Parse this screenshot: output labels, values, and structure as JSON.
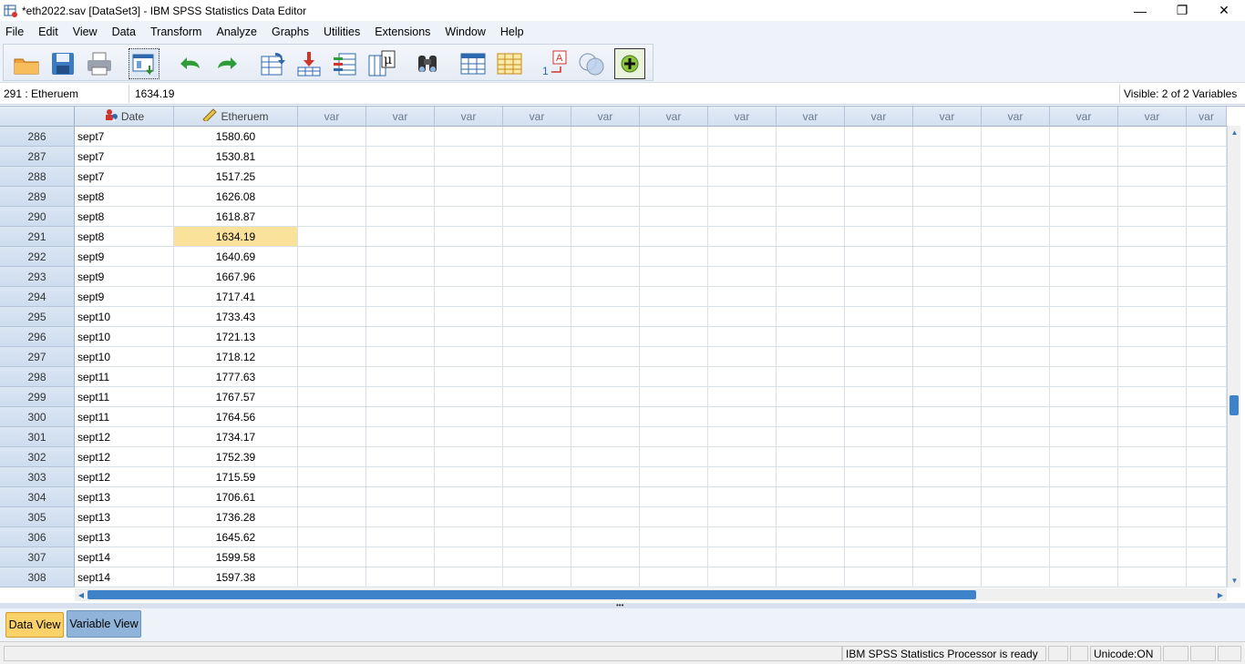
{
  "window": {
    "title": "*eth2022.sav [DataSet3] - IBM SPSS Statistics Data Editor",
    "minimize": "—",
    "maximize": "❐",
    "close": "✕"
  },
  "menu": [
    "File",
    "Edit",
    "View",
    "Data",
    "Transform",
    "Analyze",
    "Graphs",
    "Utilities",
    "Extensions",
    "Window",
    "Help"
  ],
  "toolbar_icons": [
    "open-folder-icon",
    "save-icon",
    "print-icon",
    "recall-dialog-icon",
    "undo-icon",
    "redo-icon",
    "go-to-case-icon",
    "go-to-variable-icon",
    "variables-icon",
    "run-descriptives-icon",
    "find-icon",
    "split-file-icon",
    "select-cases-icon",
    "value-labels-icon",
    "use-sets-icon",
    "show-all-variables-icon"
  ],
  "editor": {
    "cell_ref": "291 : Etheruem",
    "cell_value": "1634.19",
    "visible": "Visible: 2 of 2 Variables"
  },
  "grid": {
    "columns": [
      "Date",
      "Etheruem",
      "var",
      "var",
      "var",
      "var",
      "var",
      "var",
      "var",
      "var",
      "var",
      "var",
      "var",
      "var",
      "var",
      "var"
    ],
    "selected_row": "291",
    "rows": [
      [
        "286",
        "sept7",
        "1580.60"
      ],
      [
        "287",
        "sept7",
        "1530.81"
      ],
      [
        "288",
        "sept7",
        "1517.25"
      ],
      [
        "289",
        "sept8",
        "1626.08"
      ],
      [
        "290",
        "sept8",
        "1618.87"
      ],
      [
        "291",
        "sept8",
        "1634.19"
      ],
      [
        "292",
        "sept9",
        "1640.69"
      ],
      [
        "293",
        "sept9",
        "1667.96"
      ],
      [
        "294",
        "sept9",
        "1717.41"
      ],
      [
        "295",
        "sept10",
        "1733.43"
      ],
      [
        "296",
        "sept10",
        "1721.13"
      ],
      [
        "297",
        "sept10",
        "1718.12"
      ],
      [
        "298",
        "sept11",
        "1777.63"
      ],
      [
        "299",
        "sept11",
        "1767.57"
      ],
      [
        "300",
        "sept11",
        "1764.56"
      ],
      [
        "301",
        "sept12",
        "1734.17"
      ],
      [
        "302",
        "sept12",
        "1752.39"
      ],
      [
        "303",
        "sept12",
        "1715.59"
      ],
      [
        "304",
        "sept13",
        "1706.61"
      ],
      [
        "305",
        "sept13",
        "1736.28"
      ],
      [
        "306",
        "sept13",
        "1645.62"
      ],
      [
        "307",
        "sept14",
        "1599.58"
      ],
      [
        "308",
        "sept14",
        "1597.38"
      ]
    ]
  },
  "tabs": {
    "data_view": "Data View",
    "variable_view": "Variable View"
  },
  "status": {
    "processor": "IBM SPSS Statistics Processor is ready",
    "unicode": "Unicode:ON"
  },
  "colors": {
    "selected_cell": "#fbe29a",
    "active_tab": "#fbd16a",
    "scroll_thumb": "#3e83c9"
  }
}
